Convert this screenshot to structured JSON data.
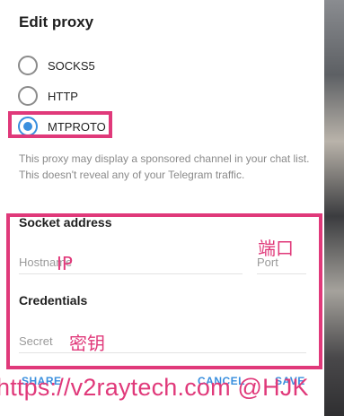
{
  "dialog": {
    "title": "Edit proxy",
    "proxy_types": [
      {
        "label": "SOCKS5",
        "checked": false
      },
      {
        "label": "HTTP",
        "checked": false
      },
      {
        "label": "MTPROTO",
        "checked": true
      }
    ],
    "notice": "This proxy may display a sponsored channel in your chat list. This doesn't reveal any of your Telegram traffic.",
    "socket_address": {
      "header": "Socket address",
      "hostname_placeholder": "Hostname",
      "port_placeholder": "Port"
    },
    "credentials": {
      "header": "Credentials",
      "secret_placeholder": "Secret"
    },
    "buttons": {
      "share": "SHARE",
      "cancel": "CANCEL",
      "save": "SAVE"
    }
  },
  "annotations": {
    "ip": "IP",
    "port": "端口",
    "secret": "密钥",
    "watermark": "https://v2raytech.com @HJK"
  },
  "colors": {
    "accent": "#3a8fde",
    "highlight": "#e0397a"
  }
}
